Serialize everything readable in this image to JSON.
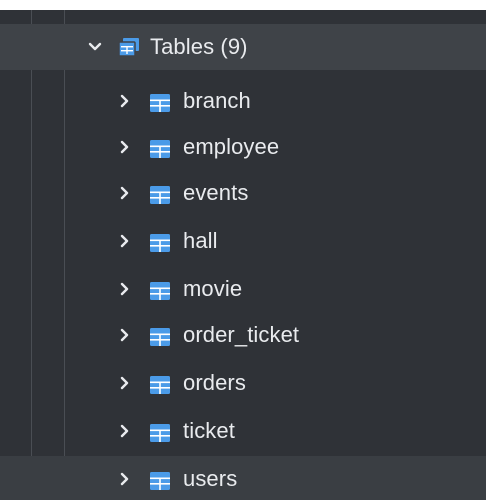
{
  "tree": {
    "group": {
      "label": "Tables (9)",
      "expanded": true,
      "icon": "table-folder-icon"
    },
    "items": [
      {
        "label": "branch"
      },
      {
        "label": "employee"
      },
      {
        "label": "events"
      },
      {
        "label": "hall"
      },
      {
        "label": "movie"
      },
      {
        "label": "order_ticket"
      },
      {
        "label": "orders"
      },
      {
        "label": "ticket"
      },
      {
        "label": "users"
      }
    ]
  },
  "colors": {
    "background": "#2f3237",
    "header_row": "#3f4348",
    "text": "#e9ebee",
    "table_icon": "#4b9be8",
    "folder_icon": "#4b9be8"
  }
}
